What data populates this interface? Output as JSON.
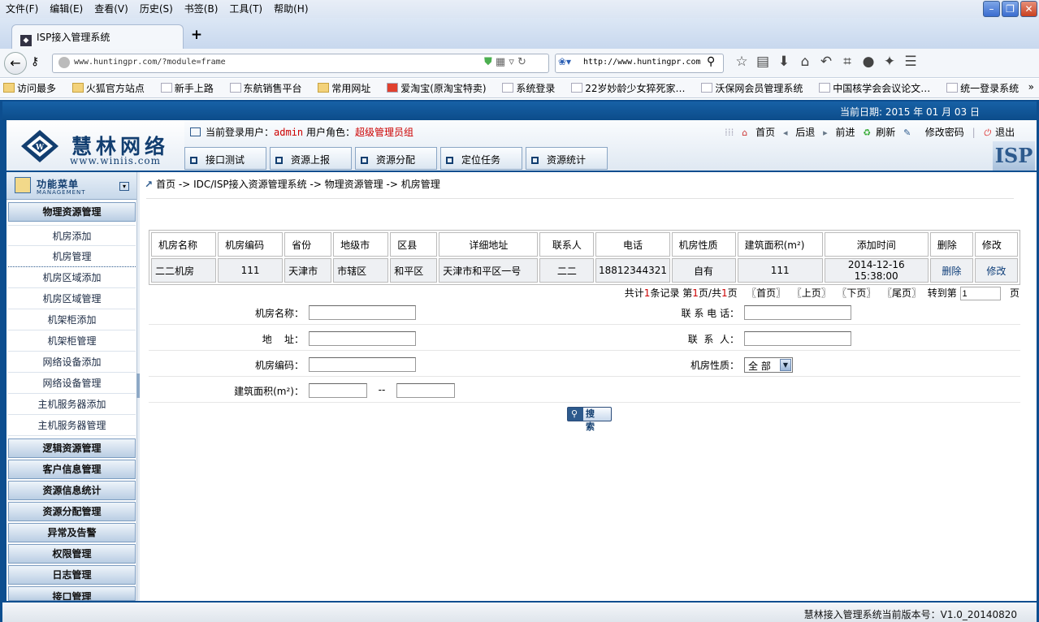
{
  "browser": {
    "menu": [
      "文件(F)",
      "编辑(E)",
      "查看(V)",
      "历史(S)",
      "书签(B)",
      "工具(T)",
      "帮助(H)"
    ],
    "tab_title": "ISP接入管理系统",
    "new_tab": "+",
    "url": "www.huntingpr.com/?module=frame",
    "search_text": "http://www.huntingpr.com",
    "bookmarks": [
      "访问最多",
      "火狐官方站点",
      "新手上路",
      "东航销售平台",
      "常用网址",
      "爱淘宝(原淘宝特卖)",
      "系统登录",
      "22岁妙龄少女猝死家…",
      "沃保网会员管理系统",
      "中国核学会会议论文…",
      "统一登录系统"
    ],
    "bookmarks_more": "»"
  },
  "app": {
    "date_label": "当前日期: 2015 年 01 月 03 日",
    "logo_name": "慧林网络",
    "logo_url": "www.winiis.com",
    "user_label": "当前登录用户：",
    "user_name": "admin",
    "role_label": " 用户角色：",
    "role_name": "超级管理员组",
    "top_links": {
      "home": "首页",
      "back": "后退",
      "forward": "前进",
      "refresh": "刷新",
      "change_password": "修改密码",
      "logout": "退出"
    },
    "top_nav": [
      "接口测试",
      "资源上报",
      "资源分配",
      "定位任务",
      "资源统计"
    ],
    "isp_badge": "ISP"
  },
  "sidebar": {
    "title": "功能菜单",
    "subtitle": "MANAGEMENT",
    "active_group": "物理资源管理",
    "items": [
      "机房添加",
      "机房管理",
      "机房区域添加",
      "机房区域管理",
      "机架柜添加",
      "机架柜管理",
      "网络设备添加",
      "网络设备管理",
      "主机服务器添加",
      "主机服务器管理"
    ],
    "groups": [
      "逻辑资源管理",
      "客户信息管理",
      "资源信息统计",
      "资源分配管理",
      "异常及告警",
      "权限管理",
      "日志管理",
      "接口管理"
    ]
  },
  "breadcrumb": "首页 -> IDC/ISP接入资源管理系统 -> 物理资源管理 -> 机房管理",
  "table": {
    "headers": [
      "机房名称",
      "机房编码",
      "省份",
      "地级市",
      "区县",
      "详细地址",
      "联系人",
      "电话",
      "机房性质",
      "建筑面积(m²)",
      "添加时间",
      "删除",
      "修改"
    ],
    "rows": [
      [
        "二二机房",
        "111",
        "天津市",
        "市辖区",
        "和平区",
        "天津市和平区一号",
        "二二",
        "18812344321",
        "自有",
        "111",
        "2014-12-16 15:38:00",
        "删除",
        "修改"
      ]
    ]
  },
  "pager": {
    "prefix": "共计",
    "total": "1",
    "records": "条记录 第",
    "page": "1",
    "page_sep": "页/共",
    "pages": "1",
    "page_suffix": "页",
    "first": "〖首页〗",
    "prev": "〖上页〗",
    "next": "〖下页〗",
    "last": "〖尾页〗",
    "goto": "转到第",
    "goto_value": "1",
    "goto_suffix": "页"
  },
  "search_form": {
    "name_label": "机房名称：",
    "phone_label": "联 系 电 话：",
    "address_label": "地    址：",
    "contact_label": "联  系  人：",
    "code_label": "机房编码：",
    "nature_label": "机房性质：",
    "nature_value": "全 部",
    "area_label": "建筑面积(m²)：",
    "area_sep": "--",
    "search_button": "搜 索"
  },
  "status_bar": "慧林接入管理系统当前版本号：V1.0_20140820"
}
